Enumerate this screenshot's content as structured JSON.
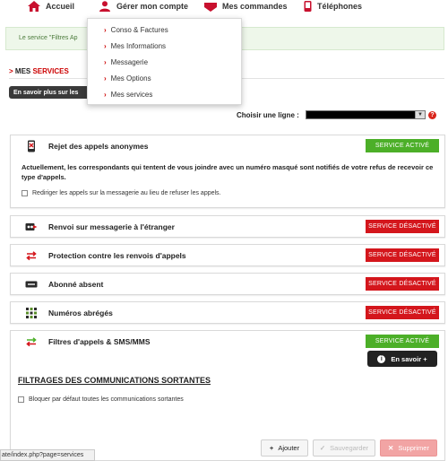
{
  "nav": {
    "items": [
      {
        "label": "Accueil",
        "icon": "home-icon"
      },
      {
        "label": "Gérer mon compte",
        "icon": "user-icon"
      },
      {
        "label": "Mes commandes",
        "icon": "shopping-bag-icon"
      },
      {
        "label": "Téléphones",
        "icon": "phone-icon"
      }
    ],
    "dropdown": [
      "Conso & Factures",
      "Mes Informations",
      "Messagerie",
      "Mes Options",
      "Mes services"
    ]
  },
  "flash": {
    "text": "Le service \"Filtres Ap"
  },
  "section": {
    "arrow": ">",
    "title_prefix": "MES ",
    "title_suffix": "SERVICES"
  },
  "learn_more": {
    "label": "En savoir plus sur les"
  },
  "line_chooser": {
    "label": "Choisir une ligne :",
    "help": "?"
  },
  "services": [
    {
      "title": "Rejet des appels anonymes",
      "status": "SERVICE ACTIVÉ",
      "icon": "phone-blocked-icon"
    },
    {
      "title": "Renvoi sur messagerie à l'étranger",
      "status": "SERVICE DÉSACTIVÉ",
      "icon": "voicemail-forward-icon"
    },
    {
      "title": "Protection contre les renvois d'appels",
      "status": "SERVICE DÉSACTIVÉ",
      "icon": "redirect-arrows-icon"
    },
    {
      "title": "Abonné absent",
      "status": "SERVICE DÉSACTIVÉ",
      "icon": "absent-subscriber-icon"
    },
    {
      "title": "Numéros abrégés",
      "status": "SERVICE DÉSACTIVÉ",
      "icon": "short-numbers-icon"
    },
    {
      "title": "Filtres d'appels & SMS/MMS",
      "status": "SERVICE ACTIVÉ",
      "icon": "filter-arrows-icon"
    }
  ],
  "anonymous": {
    "description": "Actuellement, les correspondants qui tentent de vous joindre avec un numéro masqué sont notifiés de votre refus de recevoir ce type d'appels.",
    "checkbox_label": "Rediriger les appels sur la messagerie au lieu de refuser les appels."
  },
  "filters": {
    "more_label": "En savoir +",
    "heading": "FILTRAGES DES COMMUNICATIONS SORTANTES",
    "checkbox_label": "Bloquer par défaut toutes les communications sortantes"
  },
  "actions": {
    "add": "Ajouter",
    "save": "Sauvegarder",
    "delete": "Supprimer"
  },
  "status_url": "ate/index.php?page=services",
  "colors": {
    "accent_red": "#d4161c",
    "active_green": "#4caf28"
  }
}
